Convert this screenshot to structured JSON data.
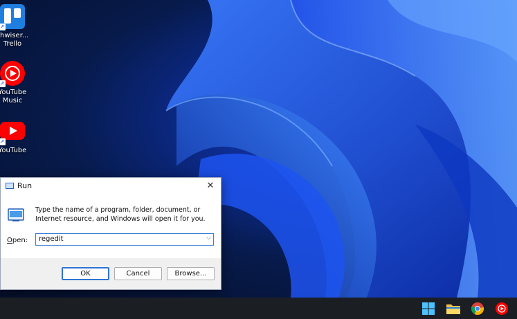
{
  "desktop": {
    "icons": [
      {
        "id": "trello",
        "label_line1": "chwiser...",
        "label_line2": "Trello",
        "icon": "trello-icon",
        "color": "#1f7fe0"
      },
      {
        "id": "youtube-music",
        "label_line1": "YouTube",
        "label_line2": "Music",
        "icon": "youtube-music-icon",
        "color": "#ff0000"
      },
      {
        "id": "youtube",
        "label_line1": "YouTube",
        "label_line2": "",
        "icon": "youtube-icon",
        "color": "#ff0000"
      }
    ]
  },
  "run_dialog": {
    "title": "Run",
    "close_glyph": "✕",
    "description": "Type the name of a program, folder, document, or Internet resource, and Windows will open it for you.",
    "open_label_accel": "O",
    "open_label_rest": "pen:",
    "open_value": "regedit",
    "buttons": {
      "ok": "OK",
      "cancel": "Cancel",
      "browse": "Browse..."
    }
  },
  "taskbar": {
    "icons": [
      "windows-start-icon",
      "file-explorer-icon",
      "chrome-icon",
      "youtube-music-icon"
    ]
  },
  "colors": {
    "accent": "#2e74d4",
    "taskbar": "#1b1f24",
    "wallpaper_blue": "#1a4be0"
  }
}
